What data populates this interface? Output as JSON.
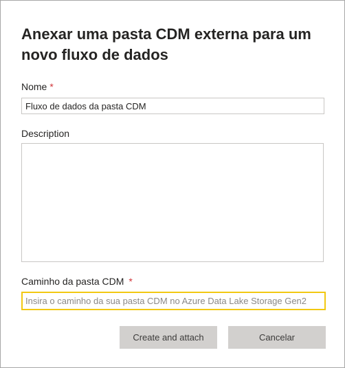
{
  "dialog": {
    "title": "Anexar uma pasta CDM externa para um novo fluxo de dados",
    "required_marker": "*",
    "name": {
      "label": "Nome",
      "value": "Fluxo de dados da pasta CDM"
    },
    "description": {
      "label": "Description",
      "value": ""
    },
    "cdm_path": {
      "label": "Caminho da pasta CDM",
      "placeholder": "Insira o caminho da sua pasta CDM no Azure Data Lake Storage Gen2",
      "value": ""
    },
    "buttons": {
      "create_label": "Create and attach",
      "cancel_label": "Cancelar"
    }
  },
  "colors": {
    "required": "#d13438",
    "focus_border": "#f2c811",
    "button_bg": "#d2d0ce"
  }
}
